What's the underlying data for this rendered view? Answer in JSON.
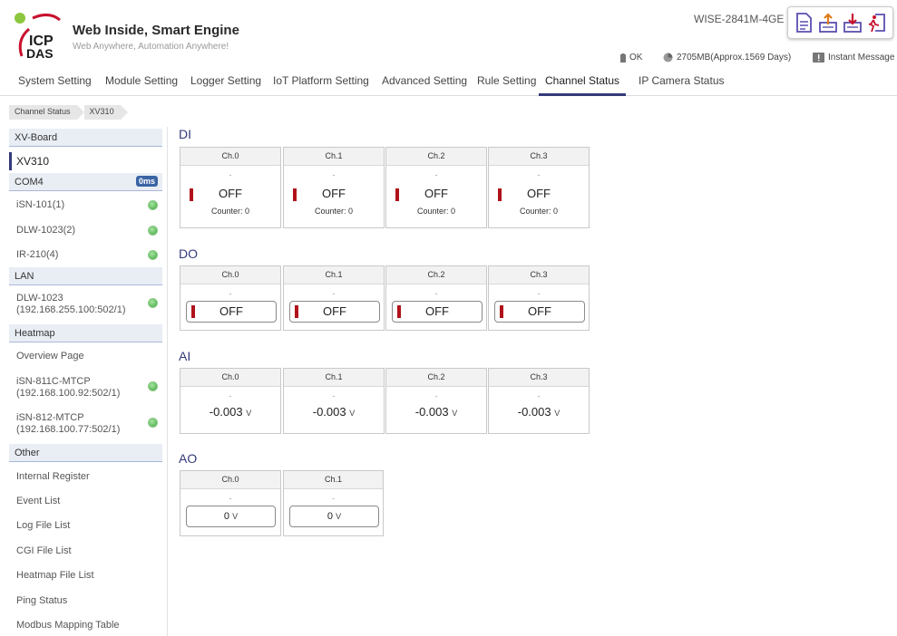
{
  "brand": {
    "title": "Web Inside, Smart Engine",
    "subtitle": "Web Anywhere, Automation Anywhere!",
    "logo_text_top": "ICP",
    "logo_text_bottom": "DAS"
  },
  "header": {
    "model": "WISE-2841M-4GE"
  },
  "toolbar": {
    "icons": [
      "document-icon",
      "upload-icon",
      "download-icon",
      "logout-icon"
    ]
  },
  "status": {
    "battery": "OK",
    "storage": "2705MB(Approx.1569 Days)",
    "message": "Instant Message"
  },
  "nav": {
    "items": [
      "System Setting",
      "Module Setting",
      "Logger Setting",
      "IoT Platform Setting",
      "Advanced Setting",
      "Rule Setting",
      "Channel Status",
      "IP Camera Status"
    ],
    "active": "Channel Status"
  },
  "breadcrumb": [
    "Channel Status",
    "XV310"
  ],
  "sidebar": {
    "sections": [
      {
        "title": "XV-Board",
        "items": [
          {
            "label": "XV310",
            "active": true
          }
        ]
      },
      {
        "title": "COM4",
        "badge": "0ms",
        "items": [
          {
            "label": "iSN-101(1)"
          },
          {
            "label": "DLW-1023(2)"
          },
          {
            "label": "IR-210(4)"
          }
        ]
      },
      {
        "title": "LAN",
        "items": [
          {
            "label": "DLW-1023",
            "sub": "(192.168.255.100:502/1)"
          }
        ]
      },
      {
        "title": "Heatmap",
        "items": [
          {
            "label": "Overview Page"
          },
          {
            "label": "iSN-811C-MTCP",
            "sub": "(192.168.100.92:502/1)"
          },
          {
            "label": "iSN-812-MTCP",
            "sub": "(192.168.100.77:502/1)"
          }
        ]
      },
      {
        "title": "Other",
        "items": [
          {
            "label": "Internal Register"
          },
          {
            "label": "Event List"
          },
          {
            "label": "Log File List"
          },
          {
            "label": "CGI File List"
          },
          {
            "label": "Heatmap File List"
          },
          {
            "label": "Ping Status"
          },
          {
            "label": "Modbus Mapping Table"
          }
        ]
      }
    ]
  },
  "di": {
    "title": "DI",
    "channels": [
      {
        "name": "Ch.0",
        "desc": "-",
        "state": "OFF",
        "counter": "Counter: 0"
      },
      {
        "name": "Ch.1",
        "desc": "-",
        "state": "OFF",
        "counter": "Counter: 0"
      },
      {
        "name": "Ch.2",
        "desc": "-",
        "state": "OFF",
        "counter": "Counter: 0"
      },
      {
        "name": "Ch.3",
        "desc": "-",
        "state": "OFF",
        "counter": "Counter: 0"
      }
    ]
  },
  "do": {
    "title": "DO",
    "channels": [
      {
        "name": "Ch.0",
        "desc": "-",
        "state": "OFF"
      },
      {
        "name": "Ch.1",
        "desc": "-",
        "state": "OFF"
      },
      {
        "name": "Ch.2",
        "desc": "-",
        "state": "OFF"
      },
      {
        "name": "Ch.3",
        "desc": "-",
        "state": "OFF"
      }
    ]
  },
  "ai": {
    "title": "AI",
    "channels": [
      {
        "name": "Ch.0",
        "desc": "-",
        "value": "-0.003",
        "unit": "V"
      },
      {
        "name": "Ch.1",
        "desc": "-",
        "value": "-0.003",
        "unit": "V"
      },
      {
        "name": "Ch.2",
        "desc": "-",
        "value": "-0.003",
        "unit": "V"
      },
      {
        "name": "Ch.3",
        "desc": "-",
        "value": "-0.003",
        "unit": "V"
      }
    ]
  },
  "ao": {
    "title": "AO",
    "channels": [
      {
        "name": "Ch.0",
        "desc": "-",
        "value": "0",
        "unit": "V"
      },
      {
        "name": "Ch.1",
        "desc": "-",
        "value": "0",
        "unit": "V"
      }
    ]
  },
  "colors": {
    "accent": "#333a7a",
    "off_indicator": "#b0121b",
    "online_dot": "#5cb85c",
    "badge": "#3a64a4"
  }
}
